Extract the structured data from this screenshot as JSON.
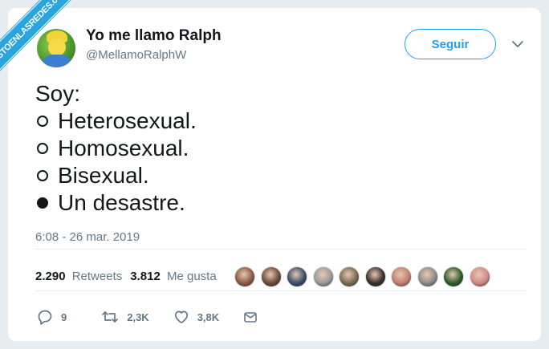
{
  "watermark": "VISTOENLASREDES.com",
  "user": {
    "name": "Yo me llamo Ralph",
    "handle": "@MellamoRalphW"
  },
  "follow_label": "Seguir",
  "tweet": {
    "lines": [
      {
        "prefix": "",
        "text": "Soy:"
      },
      {
        "prefix": "empty",
        "text": "Heterosexual."
      },
      {
        "prefix": "empty",
        "text": "Homosexual."
      },
      {
        "prefix": "empty",
        "text": "Bisexual."
      },
      {
        "prefix": "full",
        "text": "Un desastre."
      }
    ]
  },
  "timestamp": "6:08 - 26 mar. 2019",
  "stats": {
    "retweets_count": "2.290",
    "retweets_label": "Retweets",
    "likes_count": "3.812",
    "likes_label": "Me gusta"
  },
  "likers": [
    "#8a5a44",
    "#6b4a3a",
    "#3b4d6b",
    "#9a9a9a",
    "#7a6a55",
    "#3a2e2a",
    "#c08070",
    "#8c8c8c",
    "#2b5e2b",
    "#d08a8a"
  ],
  "actions": {
    "replies": "9",
    "retweets": "2,3K",
    "likes": "3,8K"
  },
  "colors": {
    "accent": "#1da1f2",
    "text": "#14171a",
    "muted": "#657786"
  }
}
